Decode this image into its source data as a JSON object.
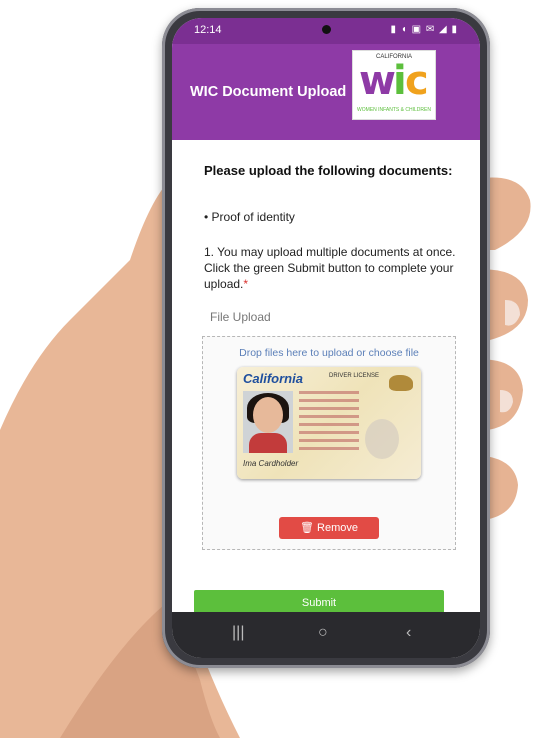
{
  "status_bar": {
    "time": "12:14",
    "icons": "▮ ◖ ▣ ✉ ◢ ▮"
  },
  "header": {
    "title": "WIC Document Upload"
  },
  "logo": {
    "top_text": "CALIFORNIA",
    "letter_w": "w",
    "letter_i": "i",
    "letter_c": "c",
    "bottom_text": "WOMEN INFANTS & CHILDREN"
  },
  "content": {
    "heading": "Please upload the following documents:",
    "bullet": "• Proof of identity",
    "instruction": "1. You may upload multiple documents at once. Click the green Submit button to complete your upload.",
    "required_mark": "*",
    "file_upload_label": "File Upload",
    "drop_hint": "Drop files here to upload or choose file"
  },
  "license": {
    "state": "California",
    "type": "DRIVER LICENSE",
    "signature": "Ima Cardholder"
  },
  "buttons": {
    "remove": "Remove",
    "submit": "Submit"
  },
  "navbar": {
    "recent": "|||",
    "home": "○",
    "back": "‹"
  },
  "colors": {
    "header": "#8e3aa6",
    "submit": "#5cbf3c",
    "remove": "#e24b45",
    "drop_hint": "#5b7fb8"
  }
}
